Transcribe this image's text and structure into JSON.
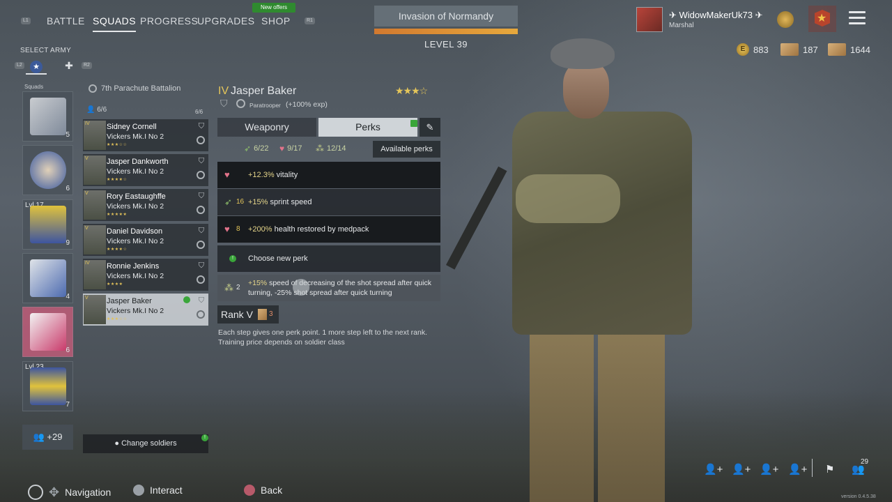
{
  "nav": {
    "l1_badge": "L1",
    "r1_badge": "R1",
    "items": [
      {
        "label": "BATTLE"
      },
      {
        "label": "SQUADS"
      },
      {
        "label": "PROGRESS"
      },
      {
        "label": "UPGRADES"
      },
      {
        "label": "SHOP"
      }
    ],
    "active_index": 1,
    "new_offers_badge": "New offers"
  },
  "event": {
    "title": "Invasion of Normandy",
    "level": "LEVEL 39",
    "progress_fraction": 1.0
  },
  "profile": {
    "username": "WidowMakerUk73",
    "rank": "Marshal"
  },
  "currency": {
    "gold": "883",
    "gold_icon": "E",
    "tickets_a": "187",
    "tickets_b": "1644"
  },
  "army_select": {
    "label": "SELECT ARMY",
    "l2_badge": "L2",
    "r2_badge": "R2"
  },
  "squads": {
    "label": "Squads",
    "cards": [
      {
        "count": "5",
        "level": ""
      },
      {
        "count": "6",
        "level": ""
      },
      {
        "count": "9",
        "level": "Lvl 17"
      },
      {
        "count": "4",
        "level": ""
      },
      {
        "count": "6",
        "level": ""
      },
      {
        "count": "7",
        "level": "Lvl 23"
      }
    ],
    "more": "+29"
  },
  "roster": {
    "battalion": "7th Parachute Battalion",
    "count": "6/6",
    "count_right": "6/6",
    "soldiers": [
      {
        "rank": "IV",
        "name": "Sidney Cornell",
        "weapon": "Vickers Mk.I No 2",
        "stars": "★★★☆☆"
      },
      {
        "rank": "V",
        "name": "Jasper Dankworth",
        "weapon": "Vickers Mk.I No 2",
        "stars": "★★★★☆"
      },
      {
        "rank": "V",
        "name": "Rory Eastaughffe",
        "weapon": "Vickers Mk.I No 2",
        "stars": "★★★★★"
      },
      {
        "rank": "V",
        "name": "Daniel Davidson",
        "weapon": "Vickers Mk.I No 2",
        "stars": "★★★★☆"
      },
      {
        "rank": "IV",
        "name": "Ronnie Jenkins",
        "weapon": "Vickers Mk.I No 2",
        "stars": "★★★★"
      },
      {
        "rank": "V",
        "name": "Jasper Baker",
        "weapon": "Vickers Mk.I No 2",
        "stars": "★★★☆☆"
      }
    ],
    "selected_index": 5,
    "change_soldiers": "Change soldiers"
  },
  "detail": {
    "rank": "IV",
    "name": "Jasper Baker",
    "stars": "★★★☆",
    "class": "Paratrooper",
    "bonus": "(+100% exp)",
    "tabs": {
      "weaponry": "Weaponry",
      "perks": "Perks"
    },
    "points": [
      {
        "value": "6/22"
      },
      {
        "value": "9/17"
      },
      {
        "value": "12/14"
      }
    ],
    "available_perks": "Available perks",
    "perks": [
      {
        "cost": "",
        "highlight": "+12.3%",
        "text": " vitality",
        "icon": "heart-icon"
      },
      {
        "cost": "16",
        "highlight": "+15%",
        "text": " sprint speed",
        "icon": "boot-icon"
      },
      {
        "cost": "8",
        "highlight": "+200%",
        "text": " health restored by medpack",
        "icon": "heart-icon"
      },
      {
        "cost": "",
        "highlight": "",
        "text": "Choose new perk",
        "icon": "info-icon"
      },
      {
        "cost": "2",
        "highlight": "+15%",
        "text": " speed of decreasing of the shot spread after quick turning, -25% shot spread after quick turning",
        "icon": "bullets-icon"
      }
    ],
    "rank_label": "Rank V",
    "rank_cost": "3",
    "rank_description": "Each step gives one perk point. 1 more step left to the next rank. Training price depends on soldier class"
  },
  "bottom_right": {
    "count": "29",
    "version": "version 0.4.5.38"
  },
  "hints": {
    "navigation": "Navigation",
    "interact": "Interact",
    "back": "Back"
  }
}
